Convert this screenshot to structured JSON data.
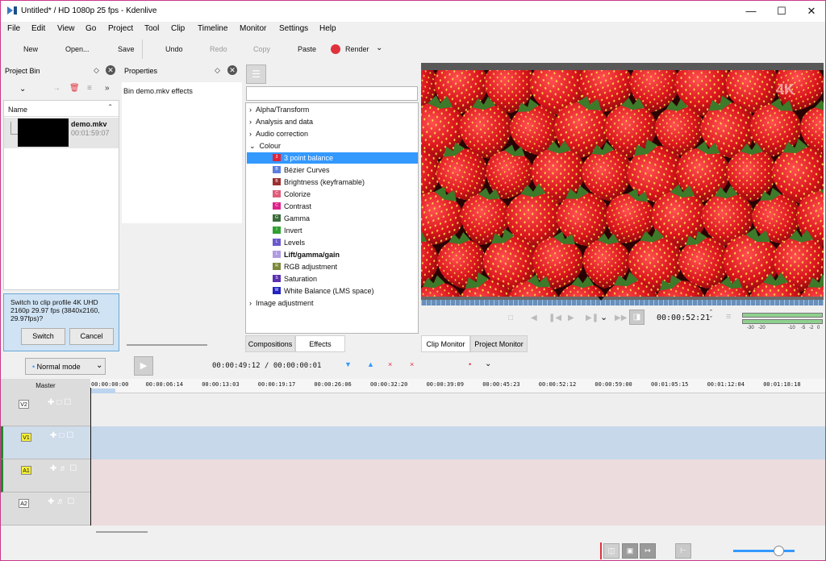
{
  "window": {
    "title": "Untitled* / HD 1080p 25 fps - Kdenlive"
  },
  "menu": [
    "File",
    "Edit",
    "View",
    "Go",
    "Project",
    "Tool",
    "Clip",
    "Timeline",
    "Monitor",
    "Settings",
    "Help"
  ],
  "toolbar": {
    "new": "New",
    "open": "Open...",
    "save": "Save",
    "undo": "Undo",
    "redo": "Redo",
    "copy": "Copy",
    "paste": "Paste",
    "render": "Render"
  },
  "project_bin": {
    "title": "Project Bin",
    "column": "Name",
    "clip": {
      "name": "demo.mkv",
      "duration": "00:01:59:07"
    },
    "prompt": "Switch to clip profile 4K UHD 2160p 29.97 fps (3840x2160, 29.97fps)?",
    "switch": "Switch",
    "cancel": "Cancel"
  },
  "properties": {
    "title": "Properties",
    "subtitle": "Bin demo.mkv effects"
  },
  "effects": {
    "categories": [
      "Alpha/Transform",
      "Analysis and data",
      "Audio correction",
      "Colour"
    ],
    "colour_items": [
      {
        "label": "3 point balance",
        "color": "#e0223a",
        "letter": "3"
      },
      {
        "label": "Bézier Curves",
        "color": "#5a7ee0",
        "letter": "B"
      },
      {
        "label": "Brightness (keyframable)",
        "color": "#9b2f2f",
        "letter": "B"
      },
      {
        "label": "Colorize",
        "color": "#e05c7a",
        "letter": "C"
      },
      {
        "label": "Contrast",
        "color": "#e0228a",
        "letter": "C"
      },
      {
        "label": "Gamma",
        "color": "#3a6b3a",
        "letter": "G"
      },
      {
        "label": "Invert",
        "color": "#2fa02f",
        "letter": "I"
      },
      {
        "label": "Levels",
        "color": "#6a5acd",
        "letter": "L"
      },
      {
        "label": "Lift/gamma/gain",
        "color": "#b09be0",
        "letter": "L"
      },
      {
        "label": "RGB adjustment",
        "color": "#7a8a3a",
        "letter": "R"
      },
      {
        "label": "Saturation",
        "color": "#5a2fb0",
        "letter": "S"
      },
      {
        "label": "White Balance (LMS space)",
        "color": "#2222c0",
        "letter": "W"
      }
    ],
    "last_category": "Image adjustment",
    "tab_compositions": "Compositions",
    "tab_effects": "Effects"
  },
  "monitor": {
    "timecode": "00:00:52:21",
    "watermark": "4K",
    "db_labels": [
      "-30",
      "-20",
      "-10",
      "-5",
      "-2",
      "0"
    ],
    "tab_clip": "Clip Monitor",
    "tab_project": "Project Monitor"
  },
  "timeline": {
    "mode": "Normal mode",
    "position": "00:00:49:12 / 00:00:00:01",
    "master": "Master",
    "ruler": [
      "00:00:00:00",
      "00:00:06:14",
      "00:00:13:03",
      "00:00:19:17",
      "00:00:26:06",
      "00:00:32:20",
      "00:00:39:09",
      "00:00:45:23",
      "00:00:52:12",
      "00:00:59:00",
      "00:01:05:15",
      "00:01:12:04",
      "00:01:18:18"
    ],
    "tracks": [
      "V2",
      "V1",
      "A1",
      "A2"
    ],
    "zoom": 0.74
  },
  "colors": {
    "accent": "#3399ff",
    "selection": "#3399ff",
    "render": "#e0323c",
    "video_track_active": "#c6d8ea",
    "audio_track": "#ecdcde"
  }
}
